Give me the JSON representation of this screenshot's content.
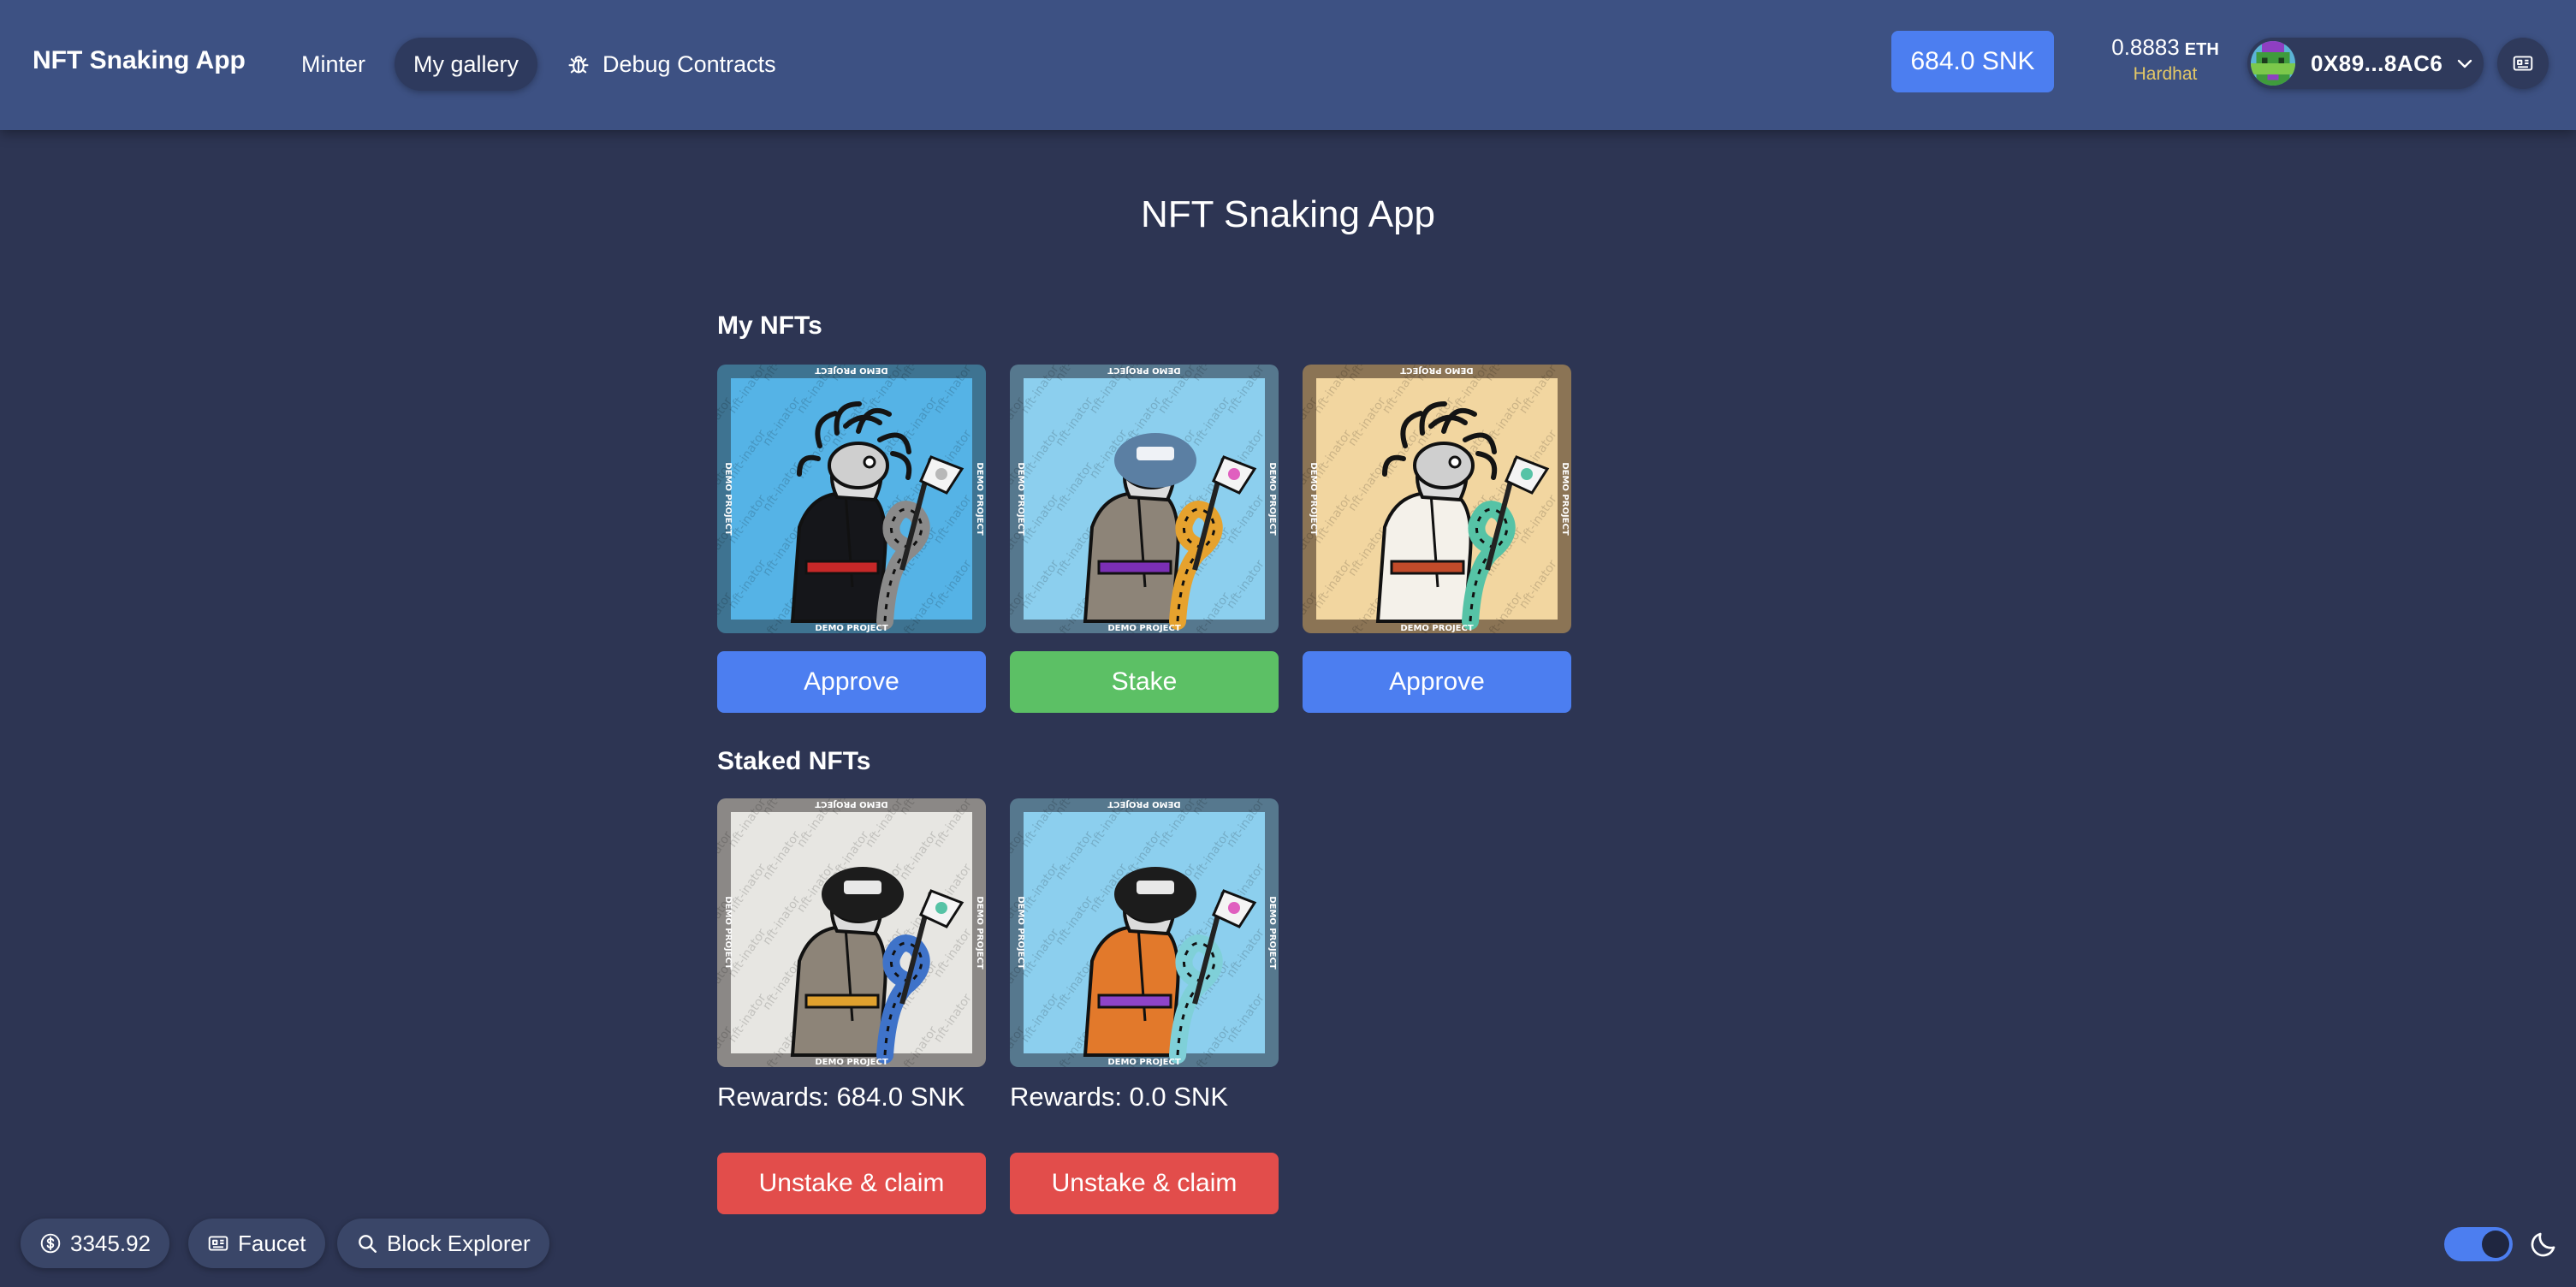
{
  "header": {
    "brand": "NFT Snaking App",
    "nav": {
      "minter": "Minter",
      "gallery": "My gallery",
      "debug": "Debug Contracts"
    },
    "snk_balance": "684.0 SNK",
    "eth_amount": "0.8883",
    "eth_unit": "ETH",
    "network": "Hardhat",
    "account_address": "0X89...8AC6"
  },
  "main": {
    "title": "NFT Snaking App",
    "my_nfts_title": "My NFTs",
    "my_nfts": [
      {
        "art": "snake-black-jacket",
        "button": "Approve",
        "button_color": "#4c7ef0"
      },
      {
        "art": "snake-pink-tan-coat",
        "button": "Stake",
        "button_color": "#5cc065"
      },
      {
        "art": "snake-teal-robe",
        "button": "Approve",
        "button_color": "#4c7ef0"
      }
    ],
    "staked_title": "Staked NFTs",
    "staked_nfts": [
      {
        "art": "snake-helmet-grey-coat",
        "rewards": "Rewards: 684.0 SNK",
        "button": "Unstake & claim"
      },
      {
        "art": "snake-helmet-orange-vest",
        "rewards": "Rewards: 0.0 SNK",
        "button": "Unstake & claim"
      }
    ],
    "nft_text": {
      "demo": "DEMO PROJECT",
      "watermark": "nft-inator"
    }
  },
  "footer": {
    "price": "3345.92",
    "faucet": "Faucet",
    "explorer": "Block Explorer"
  },
  "theme": {
    "dark_mode": true,
    "primary": "#4c7ef0",
    "success": "#5cc065",
    "danger": "#e24d4b",
    "background": "#2d3553",
    "header": "#3d5183"
  },
  "icons": [
    "debug-bug-icon",
    "chevron-down-icon",
    "qr-code-icon",
    "dollar-icon",
    "faucet-icon",
    "search-icon",
    "moon-icon"
  ]
}
